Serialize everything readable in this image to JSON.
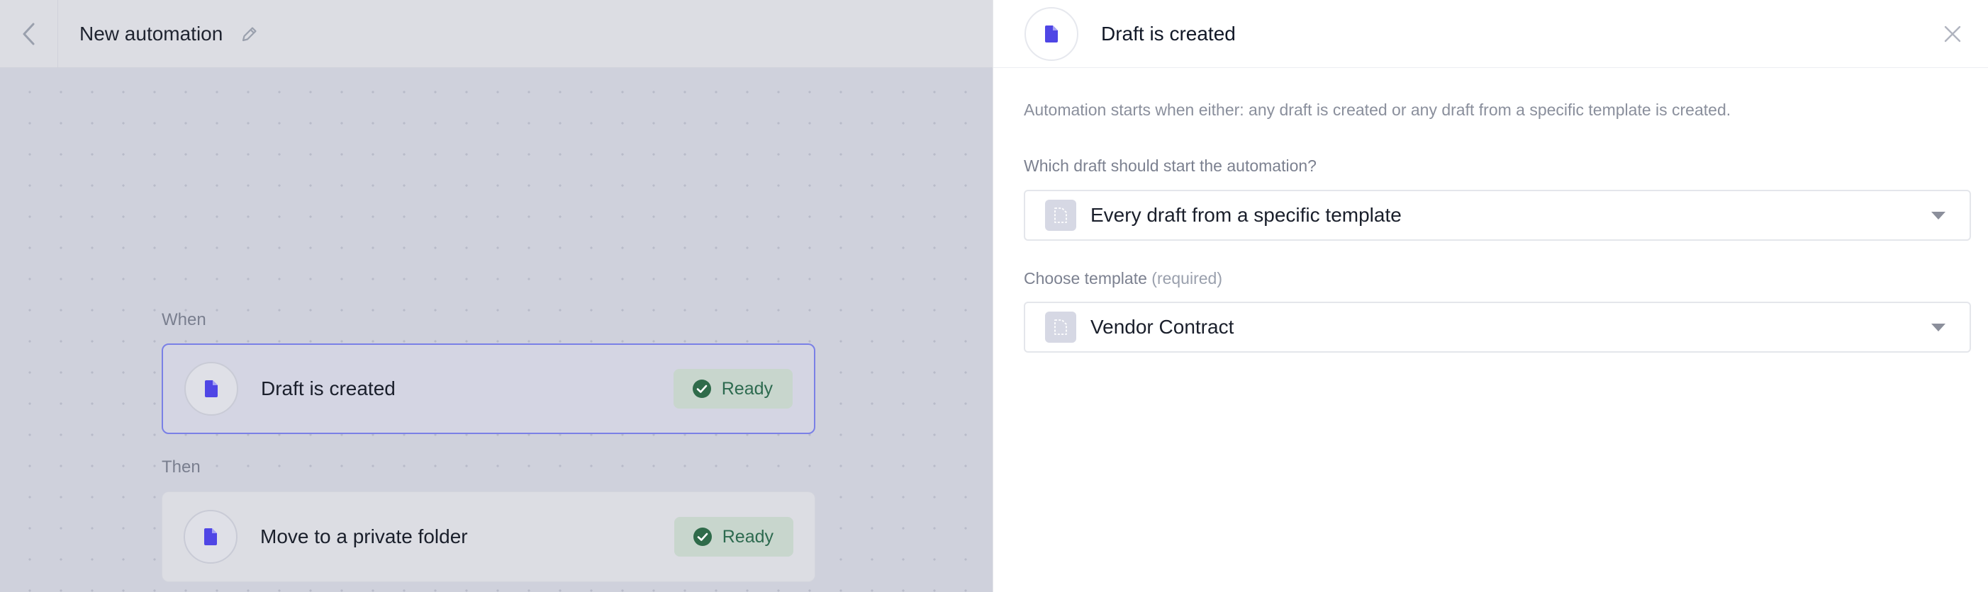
{
  "canvas": {
    "header": {
      "title": "New automation"
    },
    "when_label": "When",
    "then_label": "Then",
    "cards": [
      {
        "title": "Draft is created",
        "status": "Ready"
      },
      {
        "title": "Move to a private folder",
        "status": "Ready"
      }
    ]
  },
  "panel": {
    "title": "Draft is created",
    "description": "Automation starts when either: any draft is created or any draft from a specific template is created.",
    "trigger_field": {
      "label": "Which draft should start the automation?",
      "value": "Every draft from a specific template"
    },
    "template_field": {
      "label": "Choose template",
      "required_hint": "(required)",
      "value": "Vendor Contract"
    }
  },
  "colors": {
    "accent": "#4f46e5",
    "ready_bg": "#c8d6cd",
    "ready_text": "#2d6a4f",
    "ready_check": "#2f6b4a",
    "selected_border": "#7a80e6"
  },
  "icons": {
    "back": "chevron-left-icon",
    "edit": "pencil-icon",
    "document": "document-icon",
    "check": "check-circle-icon",
    "close": "close-icon",
    "template": "template-document-icon",
    "caret": "caret-down-icon"
  }
}
